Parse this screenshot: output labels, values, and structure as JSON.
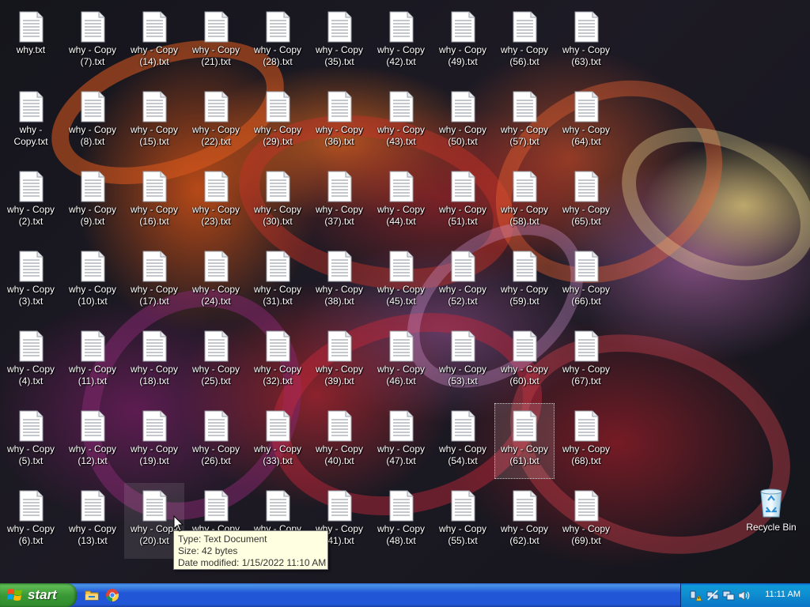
{
  "desktop": {
    "files": [
      {
        "label": "why.txt"
      },
      {
        "label": "why - Copy.txt"
      },
      {
        "label": "why - Copy (2).txt"
      },
      {
        "label": "why - Copy (3).txt"
      },
      {
        "label": "why - Copy (4).txt"
      },
      {
        "label": "why - Copy (5).txt"
      },
      {
        "label": "why - Copy (6).txt"
      },
      {
        "label": "why - Copy (7).txt"
      },
      {
        "label": "why - Copy (8).txt"
      },
      {
        "label": "why - Copy (9).txt"
      },
      {
        "label": "why - Copy (10).txt"
      },
      {
        "label": "why - Copy (11).txt"
      },
      {
        "label": "why - Copy (12).txt"
      },
      {
        "label": "why - Copy (13).txt"
      },
      {
        "label": "why - Copy (14).txt"
      },
      {
        "label": "why - Copy (15).txt"
      },
      {
        "label": "why - Copy (16).txt"
      },
      {
        "label": "why - Copy (17).txt"
      },
      {
        "label": "why - Copy (18).txt"
      },
      {
        "label": "why - Copy (19).txt"
      },
      {
        "label": "why - Copy (20).txt"
      },
      {
        "label": "why - Copy (21).txt"
      },
      {
        "label": "why - Copy (22).txt"
      },
      {
        "label": "why - Copy (23).txt"
      },
      {
        "label": "why - Copy (24).txt"
      },
      {
        "label": "why - Copy (25).txt"
      },
      {
        "label": "why - Copy (26).txt"
      },
      {
        "label": "why - Copy (27).txt"
      },
      {
        "label": "why - Copy (28).txt"
      },
      {
        "label": "why - Copy (29).txt"
      },
      {
        "label": "why - Copy (30).txt"
      },
      {
        "label": "why - Copy (31).txt"
      },
      {
        "label": "why - Copy (32).txt"
      },
      {
        "label": "why - Copy (33).txt"
      },
      {
        "label": "why - Copy (34).txt"
      },
      {
        "label": "why - Copy (35).txt"
      },
      {
        "label": "why - Copy (36).txt"
      },
      {
        "label": "why - Copy (37).txt"
      },
      {
        "label": "why - Copy (38).txt"
      },
      {
        "label": "why - Copy (39).txt"
      },
      {
        "label": "why - Copy (40).txt"
      },
      {
        "label": "why - Copy (41).txt"
      },
      {
        "label": "why - Copy (42).txt"
      },
      {
        "label": "why - Copy (43).txt"
      },
      {
        "label": "why - Copy (44).txt"
      },
      {
        "label": "why - Copy (45).txt"
      },
      {
        "label": "why - Copy (46).txt"
      },
      {
        "label": "why - Copy (47).txt"
      },
      {
        "label": "why - Copy (48).txt"
      },
      {
        "label": "why - Copy (49).txt"
      },
      {
        "label": "why - Copy (50).txt"
      },
      {
        "label": "why - Copy (51).txt"
      },
      {
        "label": "why - Copy (52).txt"
      },
      {
        "label": "why - Copy (53).txt"
      },
      {
        "label": "why - Copy (54).txt"
      },
      {
        "label": "why - Copy (55).txt"
      },
      {
        "label": "why - Copy (56).txt"
      },
      {
        "label": "why - Copy (57).txt"
      },
      {
        "label": "why - Copy (58).txt"
      },
      {
        "label": "why - Copy (59).txt"
      },
      {
        "label": "why - Copy (60).txt"
      },
      {
        "label": "why - Copy (61).txt",
        "state": "selected"
      },
      {
        "label": "why - Copy (62).txt"
      },
      {
        "label": "why - Copy (63).txt"
      },
      {
        "label": "why - Copy (64).txt"
      },
      {
        "label": "why - Copy (65).txt"
      },
      {
        "label": "why - Copy (66).txt"
      },
      {
        "label": "why - Copy (67).txt"
      },
      {
        "label": "why - Copy (68).txt"
      },
      {
        "label": "why - Copy (69).txt"
      }
    ],
    "hovered_file": "why - Copy (20).txt",
    "recycle_bin": {
      "label": "Recycle Bin",
      "icon": "recycle-bin-icon"
    }
  },
  "tooltip": {
    "type": "Type: Text Document",
    "size": "Size: 42 bytes",
    "modified": "Date modified: 1/15/2022 11:10 AM"
  },
  "taskbar": {
    "start_label": "start",
    "quick_launch": [
      {
        "icon": "folder-icon"
      },
      {
        "icon": "chrome-icon"
      }
    ],
    "tray": {
      "icons": [
        "network-warning-icon",
        "network-disabled-icon",
        "network-icon",
        "volume-icon"
      ],
      "clock": "11:11 AM"
    }
  },
  "colors": {
    "taskbar_blue": "#2157d7",
    "start_green": "#3a9a36",
    "tray_blue": "#0d8dd0",
    "tooltip_bg": "#ffffe1"
  }
}
